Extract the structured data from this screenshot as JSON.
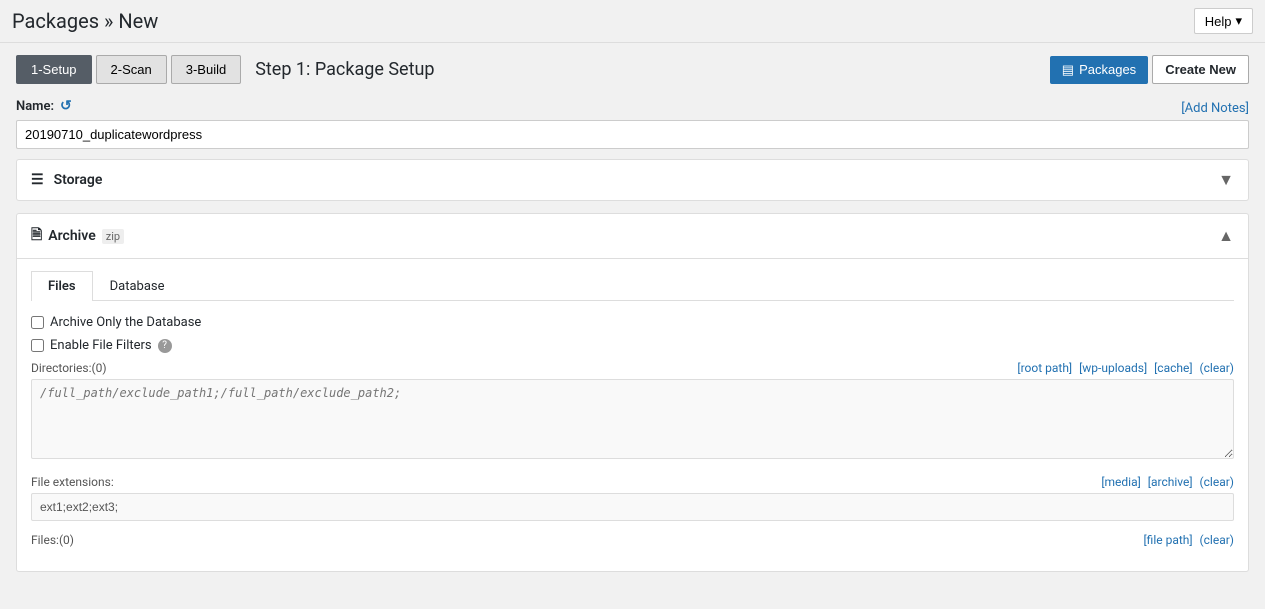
{
  "topbar": {
    "help_label": "Help",
    "chevron": "▾"
  },
  "page": {
    "title": "Packages » New"
  },
  "steps": [
    {
      "id": "setup",
      "label": "1-Setup",
      "active": true
    },
    {
      "id": "scan",
      "label": "2-Scan",
      "active": false
    },
    {
      "id": "build",
      "label": "3-Build",
      "active": false
    }
  ],
  "step_title": "Step 1: Package Setup",
  "header_actions": {
    "packages_icon": "▤",
    "packages_label": "Packages",
    "create_new_label": "Create New"
  },
  "name_section": {
    "label": "Name:",
    "reset_icon": "↺",
    "add_notes_label": "[Add Notes]",
    "value": "20190710_duplicatewordpress"
  },
  "storage_card": {
    "icon": "☰",
    "title": "Storage",
    "collapsed": true,
    "chevron_down": "▼"
  },
  "archive_card": {
    "icon": "📄",
    "title": "Archive",
    "zip_label": "zip",
    "expanded": true,
    "chevron_up": "▲",
    "tabs": [
      {
        "id": "files",
        "label": "Files",
        "active": true
      },
      {
        "id": "database",
        "label": "Database",
        "active": false
      }
    ],
    "archive_only_db_label": "Archive Only the Database",
    "enable_file_filters_label": "Enable File Filters",
    "directories_label": "Directories:",
    "directories_count": "(0)",
    "directories_links": [
      {
        "label": "[root path]",
        "href": "#"
      },
      {
        "label": "[wp-uploads]",
        "href": "#"
      },
      {
        "label": "[cache]",
        "href": "#"
      },
      {
        "label": "(clear)",
        "href": "#"
      }
    ],
    "directories_placeholder": "/full_path/exclude_path1;/full_path/exclude_path2;",
    "directories_value": "",
    "file_extensions_label": "File extensions:",
    "file_extensions_links": [
      {
        "label": "[media]",
        "href": "#"
      },
      {
        "label": "[archive]",
        "href": "#"
      },
      {
        "label": "(clear)",
        "href": "#"
      }
    ],
    "file_extensions_value": "ext1;ext2;ext3;",
    "files_label": "Files:",
    "files_count": "(0)",
    "files_links": [
      {
        "label": "[file path]",
        "href": "#"
      },
      {
        "label": "(clear)",
        "href": "#"
      }
    ]
  }
}
